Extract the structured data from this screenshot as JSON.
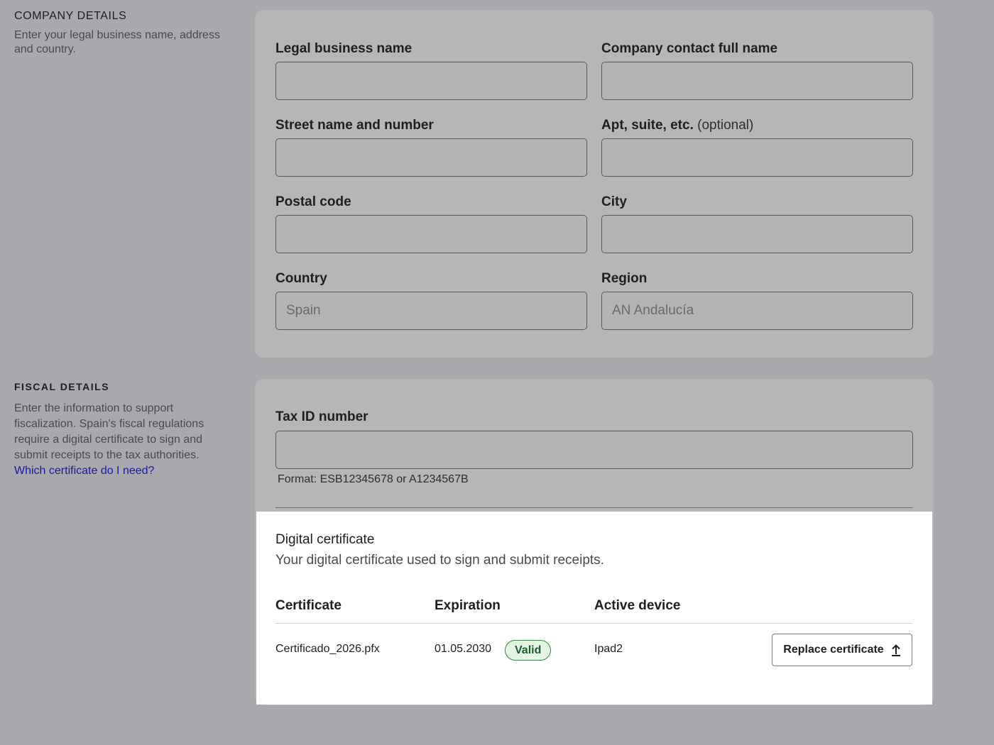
{
  "company_section": {
    "title": "COMPANY DETAILS",
    "description": "Enter your legal business name, address and country."
  },
  "company_form": {
    "legal_name_label": "Legal business name",
    "legal_name_value": "",
    "contact_label": "Company contact full name",
    "contact_value": "",
    "street_label": "Street name and number",
    "street_value": "",
    "apt_label": "Apt, suite, etc.",
    "apt_optional": "(optional)",
    "apt_value": "",
    "postal_label": "Postal code",
    "postal_value": "",
    "city_label": "City",
    "city_value": "",
    "country_label": "Country",
    "country_value": "Spain",
    "region_label": "Region",
    "region_value": "AN Andalucía"
  },
  "fiscal_section": {
    "title": "FISCAL DETAILS",
    "description": "Enter the information to support fiscalization. Spain's fiscal regulations require a digital certificate to sign and submit receipts to the tax authorities.",
    "link": "Which certificate do I need?"
  },
  "fiscal_form": {
    "tax_id_label": "Tax ID number",
    "tax_id_value": "",
    "tax_id_hint": "Format: ESB12345678 or A1234567B"
  },
  "certificate": {
    "title": "Digital certificate",
    "subtitle": "Your digital certificate used to sign and submit receipts.",
    "columns": [
      "Certificate",
      "Expiration",
      "Active device"
    ],
    "row": {
      "file": "Certificado_2026.pfx",
      "expiration": "01.05.2030",
      "status": "Valid",
      "device": "Ipad2"
    },
    "replace_label": "Replace certificate",
    "status_color": "#2f8a3f"
  }
}
